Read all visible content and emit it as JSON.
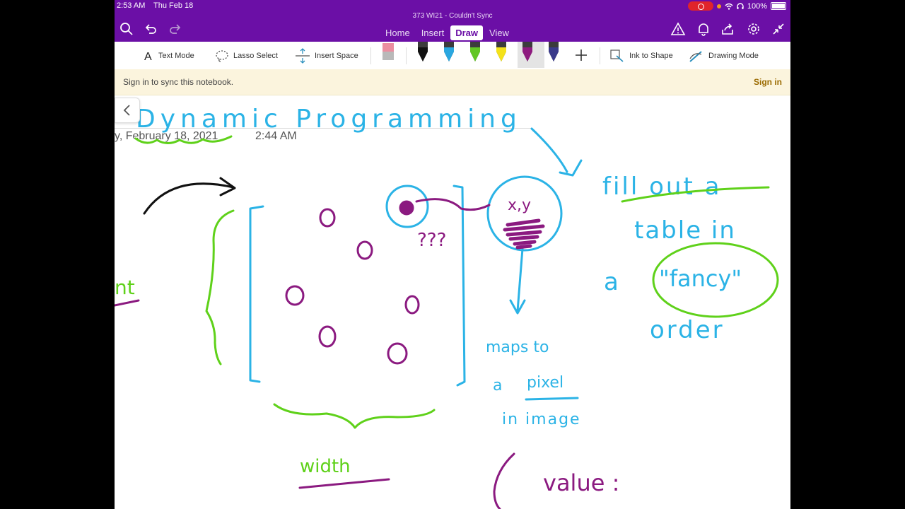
{
  "status_bar": {
    "time": "2:53 AM",
    "date": "Thu Feb 18",
    "battery": "100%"
  },
  "app": {
    "document_title": "373 WI21 - Couldn't Sync",
    "tabs": [
      "Home",
      "Insert",
      "Draw",
      "View"
    ],
    "active_tab": "Draw"
  },
  "toolbar": {
    "text_mode": "Text Mode",
    "lasso_select": "Lasso Select",
    "insert_space": "Insert Space",
    "ink_to_shape": "Ink to Shape",
    "drawing_mode": "Drawing Mode",
    "pen_colors": [
      "#111111",
      "#2aa7e0",
      "#63c624",
      "#f4e21a",
      "#8e1a7f",
      "#3a3a8a"
    ]
  },
  "banner": {
    "message": "Sign in to sync this notebook.",
    "action": "Sign in"
  },
  "page": {
    "date": "y, February 18, 2021",
    "time": "2:44 AM"
  },
  "ink": {
    "title": "Dynamic Programming",
    "note_right": [
      "fill out a",
      "table in",
      "a",
      "\"fancy\"",
      "order"
    ],
    "note_pixel": [
      "maps to",
      "a",
      "pixel",
      "in image"
    ],
    "xy_label": "x,y",
    "question": "???",
    "width_label": "width",
    "value_label": "value :",
    "left_fragment": "nt",
    "colors": {
      "blue": "#2bb3e6",
      "green": "#5fd11a",
      "purple": "#8b1a80",
      "black": "#111111"
    }
  }
}
